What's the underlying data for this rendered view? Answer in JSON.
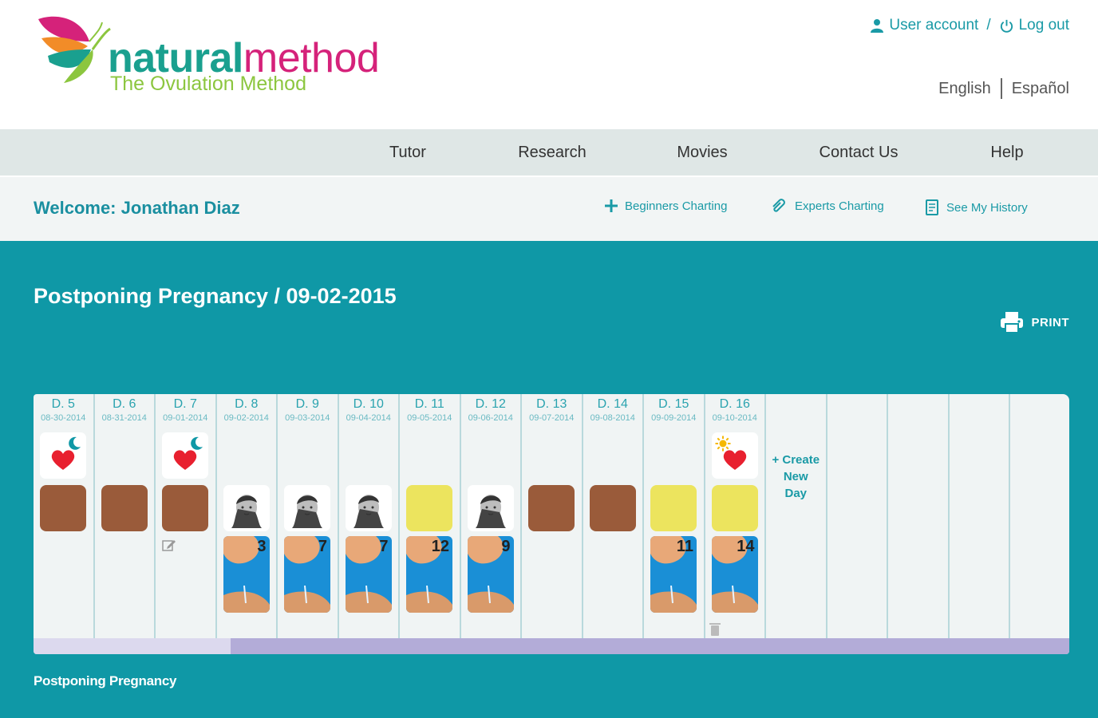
{
  "brand": {
    "name_part1": "natural",
    "name_part2": "method",
    "tagline": "The Ovulation Method"
  },
  "account": {
    "user_label": "User account",
    "separator": "/",
    "logout_label": "Log out"
  },
  "languages": [
    "English",
    "Español"
  ],
  "nav": [
    "Tutor",
    "Research",
    "Movies",
    "Contact Us",
    "Help"
  ],
  "welcome": "Welcome: Jonathan Diaz",
  "actions": {
    "beginners": "Beginners Charting",
    "experts": "Experts Charting",
    "history": "See My History"
  },
  "page_title": "Postponing Pregnancy / 09-02-2015",
  "print_label": "PRINT",
  "days": [
    {
      "label": "D. 5",
      "date": "08-30-2014",
      "symbol": "heart-moon",
      "color": "brown"
    },
    {
      "label": "D. 6",
      "date": "08-31-2014",
      "color": "brown"
    },
    {
      "label": "D. 7",
      "date": "09-01-2014",
      "symbol": "heart-moon",
      "color": "brown",
      "note": true
    },
    {
      "label": "D. 8",
      "date": "09-02-2014",
      "baby": true,
      "mucus": "3"
    },
    {
      "label": "D. 9",
      "date": "09-03-2014",
      "baby": true,
      "mucus": "7"
    },
    {
      "label": "D. 10",
      "date": "09-04-2014",
      "baby": true,
      "mucus": "7"
    },
    {
      "label": "D. 11",
      "date": "09-05-2014",
      "color": "yellow",
      "mucus": "12"
    },
    {
      "label": "D. 12",
      "date": "09-06-2014",
      "baby": true,
      "mucus": "9"
    },
    {
      "label": "D. 13",
      "date": "09-07-2014",
      "color": "brown"
    },
    {
      "label": "D. 14",
      "date": "09-08-2014",
      "color": "brown"
    },
    {
      "label": "D. 15",
      "date": "09-09-2014",
      "color": "yellow",
      "mucus": "11"
    },
    {
      "label": "D. 16",
      "date": "09-10-2014",
      "symbol": "heart-sun",
      "color": "yellow",
      "mucus": "14",
      "trash": true
    }
  ],
  "create_new_day": [
    "+ Create",
    "New",
    "Day"
  ],
  "cycle_progress": 0.19,
  "footer_label": "Postponing Pregnancy",
  "colors": {
    "teal": "#0f98a6",
    "brown": "#9a5b3a",
    "yellow": "#ece45e",
    "heart": "#e8202f",
    "magenta": "#d5227a",
    "green": "#8cc63f"
  }
}
